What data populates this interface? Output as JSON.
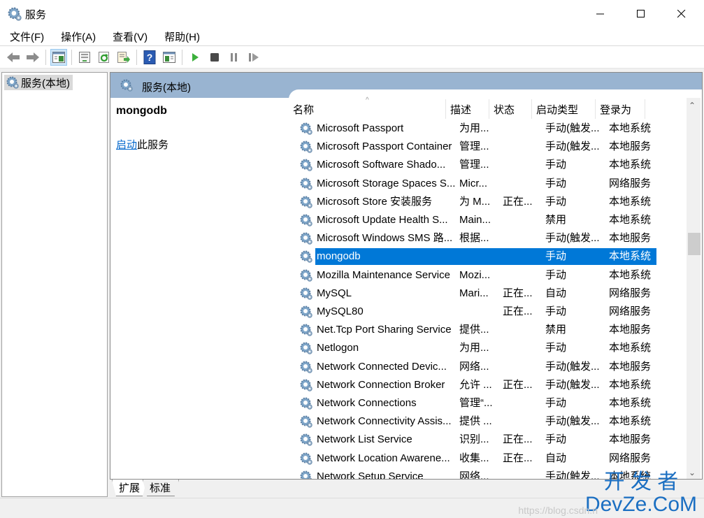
{
  "window": {
    "title": "服务",
    "controls": {
      "minimize": "minimize",
      "maximize": "maximize",
      "close": "close"
    }
  },
  "menu": [
    {
      "label": "文件(F)"
    },
    {
      "label": "操作(A)"
    },
    {
      "label": "查看(V)"
    },
    {
      "label": "帮助(H)"
    }
  ],
  "toolbar": {
    "buttons": [
      "back-icon",
      "forward-icon",
      "show-hide-console-tree-icon",
      "properties-icon",
      "refresh-icon",
      "export-list-icon",
      "help-icon",
      "show-action-pane-icon",
      "start-service-icon",
      "stop-service-icon",
      "pause-service-icon",
      "resume-service-icon"
    ]
  },
  "tree": {
    "root_label": "服务(本地)"
  },
  "content": {
    "header_title": "服务(本地)",
    "selected_service": "mongodb",
    "action_link": "启动",
    "action_suffix": "此服务"
  },
  "list": {
    "columns": [
      "名称",
      "描述",
      "状态",
      "启动类型",
      "登录为"
    ],
    "rows": [
      {
        "name": "Microsoft Passport",
        "desc": "为用...",
        "status": "",
        "startup": "手动(触发...",
        "logon": "本地系统"
      },
      {
        "name": "Microsoft Passport Container",
        "desc": "管理...",
        "status": "",
        "startup": "手动(触发...",
        "logon": "本地服务"
      },
      {
        "name": "Microsoft Software Shado...",
        "desc": "管理...",
        "status": "",
        "startup": "手动",
        "logon": "本地系统"
      },
      {
        "name": "Microsoft Storage Spaces S...",
        "desc": "Micr...",
        "status": "",
        "startup": "手动",
        "logon": "网络服务"
      },
      {
        "name": "Microsoft Store 安装服务",
        "desc": "为 M...",
        "status": "正在...",
        "startup": "手动",
        "logon": "本地系统"
      },
      {
        "name": "Microsoft Update Health S...",
        "desc": "Main...",
        "status": "",
        "startup": "禁用",
        "logon": "本地系统"
      },
      {
        "name": "Microsoft Windows SMS 路...",
        "desc": "根据...",
        "status": "",
        "startup": "手动(触发...",
        "logon": "本地服务"
      },
      {
        "name": "mongodb",
        "desc": "",
        "status": "",
        "startup": "手动",
        "logon": "本地系统",
        "selected": true
      },
      {
        "name": "Mozilla Maintenance Service",
        "desc": "Mozi...",
        "status": "",
        "startup": "手动",
        "logon": "本地系统"
      },
      {
        "name": "MySQL",
        "desc": "Mari...",
        "status": "正在...",
        "startup": "自动",
        "logon": "网络服务"
      },
      {
        "name": "MySQL80",
        "desc": "",
        "status": "正在...",
        "startup": "手动",
        "logon": "网络服务"
      },
      {
        "name": "Net.Tcp Port Sharing Service",
        "desc": "提供...",
        "status": "",
        "startup": "禁用",
        "logon": "本地服务"
      },
      {
        "name": "Netlogon",
        "desc": "为用...",
        "status": "",
        "startup": "手动",
        "logon": "本地系统"
      },
      {
        "name": "Network Connected Devic...",
        "desc": "网络...",
        "status": "",
        "startup": "手动(触发...",
        "logon": "本地服务"
      },
      {
        "name": "Network Connection Broker",
        "desc": "允许 ...",
        "status": "正在...",
        "startup": "手动(触发...",
        "logon": "本地系统"
      },
      {
        "name": "Network Connections",
        "desc": "管理“...",
        "status": "",
        "startup": "手动",
        "logon": "本地系统"
      },
      {
        "name": "Network Connectivity Assis...",
        "desc": "提供 ...",
        "status": "",
        "startup": "手动(触发...",
        "logon": "本地系统"
      },
      {
        "name": "Network List Service",
        "desc": "识别...",
        "status": "正在...",
        "startup": "手动",
        "logon": "本地服务"
      },
      {
        "name": "Network Location Awarene...",
        "desc": "收集...",
        "status": "正在...",
        "startup": "自动",
        "logon": "网络服务"
      },
      {
        "name": "Network Setup Service",
        "desc": "网络...",
        "status": "",
        "startup": "手动(触发...",
        "logon": "本地系统"
      }
    ]
  },
  "tabs": [
    {
      "label": "扩展",
      "active": true
    },
    {
      "label": "标准",
      "active": false
    }
  ],
  "watermark": {
    "line1": "开 发 者",
    "line2": "DevZe.CoM",
    "url": "https://blog.csdn.n"
  },
  "colors": {
    "selection": "#0078d7",
    "header": "#99b4d1",
    "link": "#0066cc"
  }
}
